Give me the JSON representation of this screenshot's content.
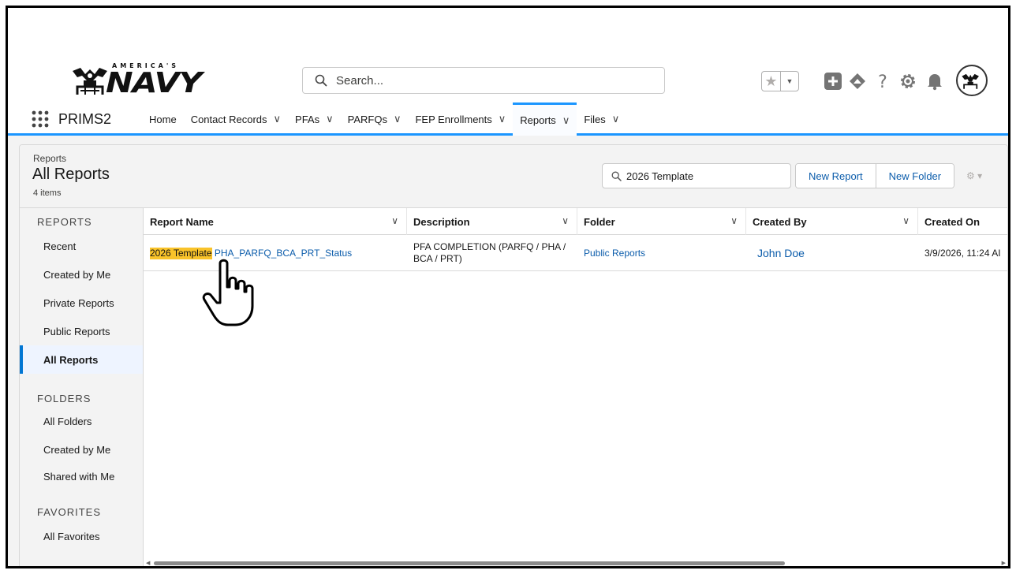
{
  "header": {
    "logo_small_text": "AMERICA'S",
    "logo_text": "NAVY",
    "search_placeholder": "Search..."
  },
  "nav": {
    "app_name": "PRIMS2",
    "items": [
      {
        "label": "Home",
        "dropdown": false
      },
      {
        "label": "Contact Records",
        "dropdown": true
      },
      {
        "label": "PFAs",
        "dropdown": true
      },
      {
        "label": "PARFQs",
        "dropdown": true
      },
      {
        "label": "FEP Enrollments",
        "dropdown": true
      },
      {
        "label": "Reports",
        "dropdown": true,
        "active": true
      },
      {
        "label": "Files",
        "dropdown": true
      }
    ]
  },
  "page_header": {
    "breadcrumb": "Reports",
    "title": "All Reports",
    "count": "4 items",
    "search_value": "2026 Template",
    "new_report": "New Report",
    "new_folder": "New Folder"
  },
  "sidebar": {
    "sections": [
      {
        "label": "REPORTS",
        "items": [
          "Recent",
          "Created by Me",
          "Private Reports",
          "Public Reports",
          "All Reports"
        ]
      },
      {
        "label": "FOLDERS",
        "items": [
          "All Folders",
          "Created by Me",
          "Shared with Me"
        ]
      },
      {
        "label": "FAVORITES",
        "items": [
          "All Favorites"
        ]
      }
    ],
    "active_item": "All Reports"
  },
  "table": {
    "columns": [
      "Report Name",
      "Description",
      "Folder",
      "Created By",
      "Created On"
    ],
    "rows": [
      {
        "name_highlight": "2026 Template",
        "name_rest": "PHA_PARFQ_BCA_PRT_Status",
        "description": "PFA COMPLETION (PARFQ / PHA / BCA / PRT)",
        "folder": "Public Reports",
        "created_by": "John Doe",
        "created_on": "3/9/2026, 11:24 AI"
      }
    ]
  },
  "colors": {
    "brand_blue": "#1b96ff",
    "link_blue": "#0b5cab",
    "highlight": "#f9c32a"
  },
  "icons": [
    "search-icon",
    "favorite-star-icon",
    "add-icon",
    "trailhead-icon",
    "help-icon",
    "setup-gear-icon",
    "notification-bell-icon",
    "avatar-icon",
    "app-launcher-icon",
    "hand-pointer-cursor-icon"
  ]
}
